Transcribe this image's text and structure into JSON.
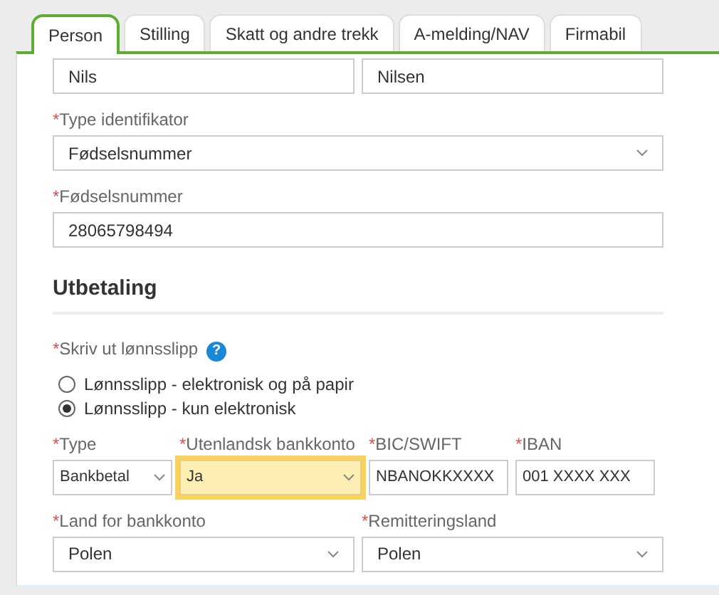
{
  "tabs": [
    {
      "label": "Person",
      "selected": true
    },
    {
      "label": "Stilling",
      "selected": false
    },
    {
      "label": "Skatt og andre trekk",
      "selected": false
    },
    {
      "label": "A-melding/NAV",
      "selected": false
    },
    {
      "label": "Firmabil",
      "selected": false
    }
  ],
  "rows": [
    {
      "kind": "fields",
      "fields": [
        {
          "kind": "input",
          "value": "Nils"
        },
        {
          "kind": "input",
          "value": "Nilsen"
        }
      ]
    },
    {
      "kind": "fields",
      "fields": [
        {
          "kind": "select",
          "mark": "*",
          "label": "Type identifikator",
          "value": "Fødselsnummer"
        }
      ]
    },
    {
      "kind": "fields",
      "fields": [
        {
          "kind": "input",
          "mark": "*",
          "label": "Fødselsnummer",
          "value": "28065798494"
        }
      ]
    },
    {
      "kind": "heading",
      "text": "Utbetaling"
    },
    {
      "kind": "radio_group",
      "mark": "*",
      "label": "Skriv ut lønnsslipp",
      "help": "?",
      "options": [
        {
          "label": "Lønnsslipp - elektronisk og på papir",
          "selected": false
        },
        {
          "label": "Lønnsslipp - kun elektronisk",
          "selected": true
        }
      ]
    },
    {
      "kind": "fields",
      "fields": [
        {
          "kind": "select",
          "mark": "*",
          "label": "Type",
          "value": "Bankbetal",
          "highlighted": false
        },
        {
          "kind": "select",
          "mark": "*",
          "label": "Utenlandsk bankkonto",
          "value": "Ja",
          "highlighted": true
        },
        {
          "kind": "input",
          "mark": "*",
          "label": "BIC/SWIFT",
          "value": "NBANOKKXXXX"
        },
        {
          "kind": "input",
          "mark": "*",
          "label": "IBAN",
          "value": "001 XXXX XXX"
        }
      ]
    },
    {
      "kind": "fields",
      "fields": [
        {
          "kind": "select",
          "mark": "*",
          "label": "Land for bankkonto",
          "value": "Polen"
        },
        {
          "kind": "select",
          "mark": "*",
          "label": "Remitteringsland",
          "value": "Polen"
        }
      ]
    }
  ]
}
